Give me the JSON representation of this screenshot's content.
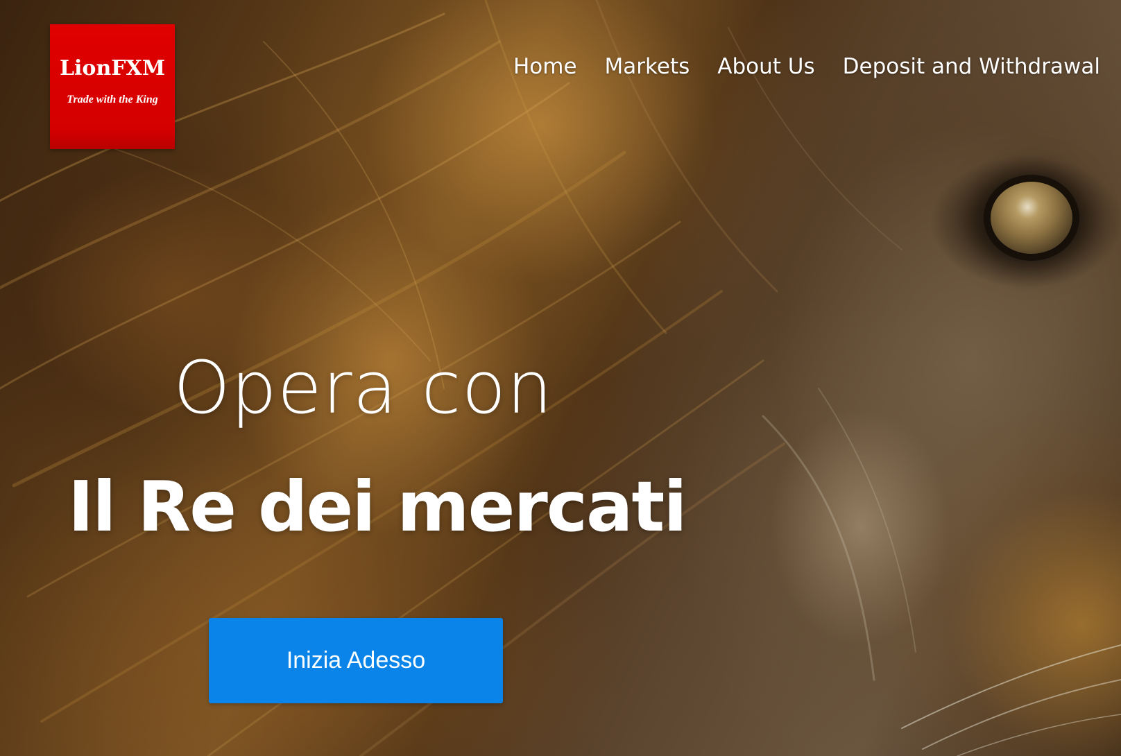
{
  "logo": {
    "name": "LionFXM",
    "tagline": "Trade with the King",
    "background_color": "#e00000"
  },
  "nav": {
    "items": [
      {
        "label": "Home"
      },
      {
        "label": "Markets"
      },
      {
        "label": "About Us"
      },
      {
        "label": "Deposit and Withdrawal"
      }
    ]
  },
  "hero": {
    "background_image": "lion-face-photo",
    "headline_line1": "Opera con",
    "headline_line2": "Il Re dei mercati",
    "cta_label": "Inizia Adesso",
    "cta_color": "#0a84e8"
  }
}
